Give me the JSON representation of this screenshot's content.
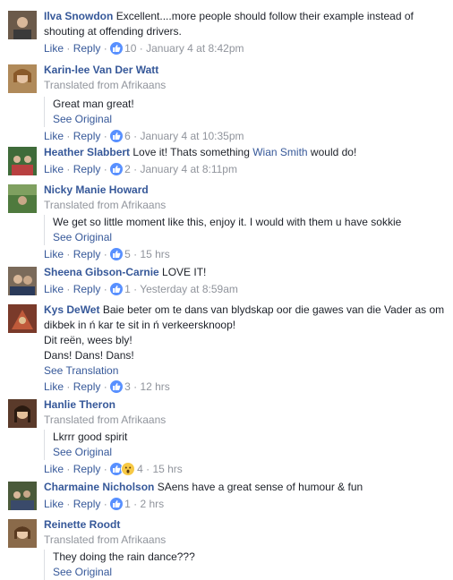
{
  "actions": {
    "like": "Like",
    "reply": "Reply",
    "dot": "·"
  },
  "comments": [
    {
      "name": "Ilva Snowdon",
      "text": "Excellent....more people should follow their example instead of shouting at offending drivers.",
      "count": "10",
      "time": "January 4 at 8:42pm",
      "avatar_color": "#6b5a4a"
    },
    {
      "name": "Karin-lee Van Der Watt",
      "translated": "Translated from Afrikaans",
      "text": "Great man great!",
      "see": "See Original",
      "count": "6",
      "time": "January 4 at 10:35pm",
      "avatar_color": "#b08a5a"
    },
    {
      "name": "Heather Slabbert",
      "text_before": "Love it! Thats something ",
      "mention": "Wian Smith",
      "text_after": " would do!",
      "count": "2",
      "time": "January 4 at 8:11pm",
      "avatar_color": "#3f6b3a"
    },
    {
      "name": "Nicky Manie Howard",
      "translated": "Translated from Afrikaans",
      "text": "We get so little moment like this, enjoy it. I would with them u have sokkie",
      "see": "See Original",
      "count": "5",
      "time": "15 hrs",
      "avatar_color": "#4f7a3e"
    },
    {
      "name": "Sheena Gibson-Carnie",
      "text": "LOVE IT!",
      "count": "1",
      "time": "Yesterday at 8:59am",
      "avatar_color": "#7a6a5a"
    },
    {
      "name": "Kys DeWet",
      "text": "Baie beter om te dans van blydskap oor die gawes van die Vader as om dikbek in ń kar te sit in ń verkeersknoop!",
      "line2": "Dit reën, wees bly!",
      "line3": "Dans! Dans! Dans!",
      "see": "See Translation",
      "count": "3",
      "time": "12 hrs",
      "avatar_color": "#7a3a2a"
    },
    {
      "name": "Hanlie Theron",
      "translated": "Translated from Afrikaans",
      "text": "Lkrrr good spirit",
      "see": "See Original",
      "count": "4",
      "time": "15 hrs",
      "avatar_color": "#5a3a2a"
    },
    {
      "name": "Charmaine Nicholson",
      "text": "SAens have a great sense of humour & fun",
      "count": "1",
      "time": "2 hrs",
      "avatar_color": "#4a5a3a"
    },
    {
      "name": "Reinette Roodt",
      "translated": "Translated from Afrikaans",
      "text": "They doing the rain dance???",
      "see": "See Original",
      "avatar_color": "#8a6a4a"
    }
  ]
}
